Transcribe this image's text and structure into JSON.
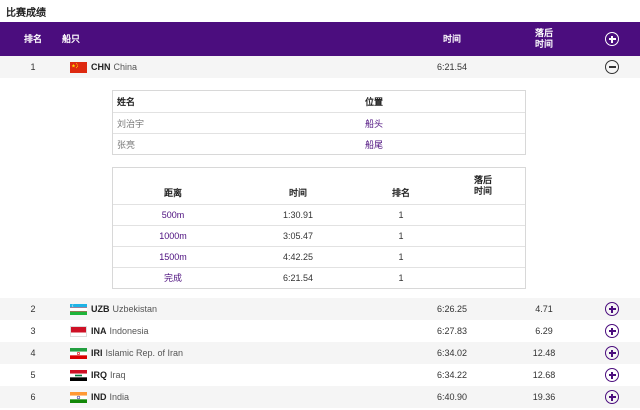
{
  "section_title": "比赛成绩",
  "header": {
    "rank": "排名",
    "boat": "船只",
    "time": "时间",
    "behind": "落后时间"
  },
  "results": [
    {
      "rank": "1",
      "code": "CHN",
      "country": "China",
      "time": "6:21.54",
      "behind": "",
      "flag": "cn-flag-icon",
      "expanded": true
    },
    {
      "rank": "2",
      "code": "UZB",
      "country": "Uzbekistan",
      "time": "6:26.25",
      "behind": "4.71",
      "flag": "uz-flag-icon",
      "expanded": false
    },
    {
      "rank": "3",
      "code": "INA",
      "country": "Indonesia",
      "time": "6:27.83",
      "behind": "6.29",
      "flag": "id-flag-icon",
      "expanded": false
    },
    {
      "rank": "4",
      "code": "IRI",
      "country": "Islamic Rep. of Iran",
      "time": "6:34.02",
      "behind": "12.48",
      "flag": "ir-flag-icon",
      "expanded": false
    },
    {
      "rank": "5",
      "code": "IRQ",
      "country": "Iraq",
      "time": "6:34.22",
      "behind": "12.68",
      "flag": "iq-flag-icon",
      "expanded": false
    },
    {
      "rank": "6",
      "code": "IND",
      "country": "India",
      "time": "6:40.90",
      "behind": "19.36",
      "flag": "in-flag-icon",
      "expanded": false
    }
  ],
  "crew": {
    "header_name": "姓名",
    "header_position": "位置",
    "members": [
      {
        "name": "刘治宇",
        "position": "船头"
      },
      {
        "name": "张亮",
        "position": "船尾"
      }
    ]
  },
  "splits": {
    "header_distance": "距离",
    "header_time": "时间",
    "header_rank": "排名",
    "header_behind": "落后时间",
    "rows": [
      {
        "distance": "500m",
        "time": "1:30.91",
        "rank": "1",
        "behind": ""
      },
      {
        "distance": "1000m",
        "time": "3:05.47",
        "rank": "1",
        "behind": ""
      },
      {
        "distance": "1500m",
        "time": "4:42.25",
        "rank": "1",
        "behind": ""
      },
      {
        "distance": "完成",
        "time": "6:21.54",
        "rank": "1",
        "behind": ""
      }
    ]
  },
  "colors": {
    "header_bg": "#4b0d7e",
    "accent": "#4b0d7e",
    "row_alt_bg": "#f5f5f5"
  },
  "icons": {
    "header_toggle": "plus-circle-icon",
    "collapse": "minus-circle-icon",
    "expand": "plus-circle-icon"
  }
}
